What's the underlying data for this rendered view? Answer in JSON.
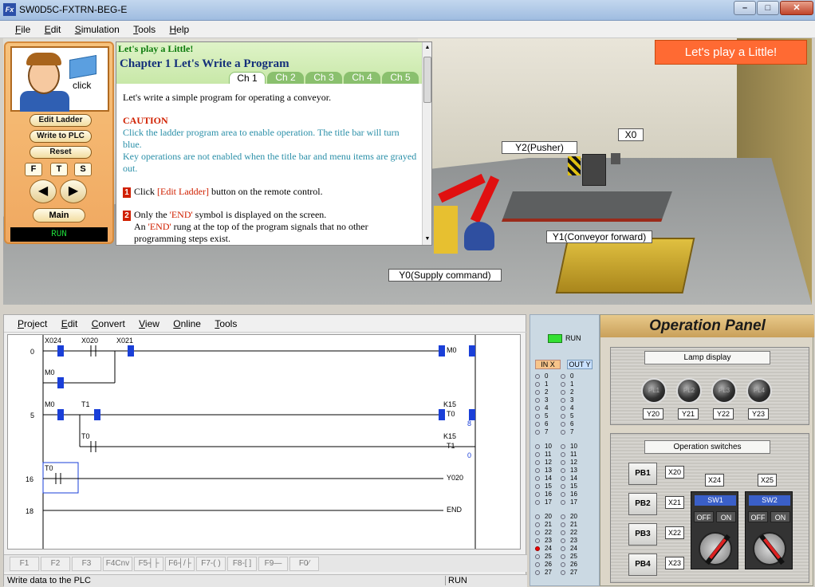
{
  "window": {
    "title": "SW0D5C-FXTRN-BEG-E",
    "icon_label": "Fx",
    "controls": [
      "–",
      "□",
      "✕"
    ]
  },
  "menubar": [
    "File",
    "Edit",
    "Simulation",
    "Tools",
    "Help"
  ],
  "remote": {
    "click_label": "click",
    "buttons": [
      "Edit Ladder",
      "Write to PLC",
      "Reset"
    ],
    "small_buttons": [
      "F",
      "T",
      "S"
    ],
    "nav_prev": "◀",
    "nav_next": "▶",
    "main": "Main",
    "run_status": "RUN"
  },
  "lesson": {
    "kicker": "Let's play a Little!",
    "chapter": "Chapter 1  Let's Write a Program",
    "tabs": [
      "Ch 1",
      "Ch 2",
      "Ch 3",
      "Ch 4",
      "Ch 5"
    ],
    "intro": "Let's write a simple program for operating a conveyor.",
    "caution_title": "CAUTION",
    "caution_1": "Click the ladder program area to enable operation. The title bar will turn blue.",
    "caution_2": "Key operations are not enabled when the title bar and menu items are grayed out.",
    "step1_num": "1",
    "step1_a": "Click ",
    "step1_b": "[Edit Ladder]",
    "step1_c": " button on the remote control.",
    "step2_num": "2",
    "step2_a": "Only the ",
    "step2_b": "'END'",
    "step2_c": " symbol is displayed on the screen.",
    "step2_d": "An ",
    "step2_e": "'END'",
    "step2_f": " rung at the top of the program signals that no other programming steps exist."
  },
  "scene": {
    "banner": "Let's play a Little!",
    "labels": {
      "y2": "Y2(Pusher)",
      "x0": "X0",
      "y1": "Y1(Conveyor forward)",
      "y0": "Y0(Supply command)"
    }
  },
  "ladder": {
    "menubar": [
      "Project",
      "Edit",
      "Convert",
      "View",
      "Online",
      "Tools"
    ],
    "step_numbers": [
      "0",
      "5",
      "16",
      "18"
    ],
    "contacts": [
      "X024",
      "X020",
      "X021",
      "M0",
      "M0",
      "T1",
      "T0",
      "T0"
    ],
    "coils": [
      "M0",
      "T0",
      "T1",
      "Y020",
      "END"
    ],
    "const_k15_a": "K15",
    "const_k15_b": "K15",
    "timer_value_a": "8",
    "timer_value_b": "0",
    "fkeys": [
      "F1",
      "F2",
      "F3",
      "F4Cnv",
      "F5┤├",
      "F6┤/├",
      "F7-( )",
      "F8-[ ]",
      "F9—",
      "F0∕"
    ],
    "status_left": "Write data to the PLC",
    "status_run": "RUN"
  },
  "io": {
    "run_label": "RUN",
    "in_head": "IN X",
    "out_head": "OUT Y",
    "rows": [
      "0",
      "1",
      "2",
      "3",
      "4",
      "5",
      "6",
      "7",
      "10",
      "11",
      "12",
      "13",
      "14",
      "15",
      "16",
      "17",
      "20",
      "21",
      "22",
      "23",
      "24",
      "25",
      "26",
      "27"
    ],
    "on_input": "24"
  },
  "op_panel": {
    "title": "Operation Panel",
    "lamp_display": "Lamp display",
    "lamps": [
      {
        "name": "PL1",
        "addr": "Y20"
      },
      {
        "name": "PL2",
        "addr": "Y21"
      },
      {
        "name": "PL3",
        "addr": "Y22"
      },
      {
        "name": "PL4",
        "addr": "Y23"
      }
    ],
    "operation_switches": "Operation switches",
    "pbs": [
      {
        "name": "PB1",
        "addr": "X20"
      },
      {
        "name": "PB2",
        "addr": "X21"
      },
      {
        "name": "PB3",
        "addr": "X22"
      },
      {
        "name": "PB4",
        "addr": "X23"
      }
    ],
    "sw_addrs": [
      "X24",
      "X25"
    ],
    "switches": [
      {
        "name": "SW1",
        "off": "OFF",
        "on": "ON"
      },
      {
        "name": "SW2",
        "off": "OFF",
        "on": "ON"
      }
    ]
  },
  "colors": {
    "accent": "#ff6a33",
    "run_green": "#1edc3a",
    "contact_blue": "#1a3fd8"
  }
}
